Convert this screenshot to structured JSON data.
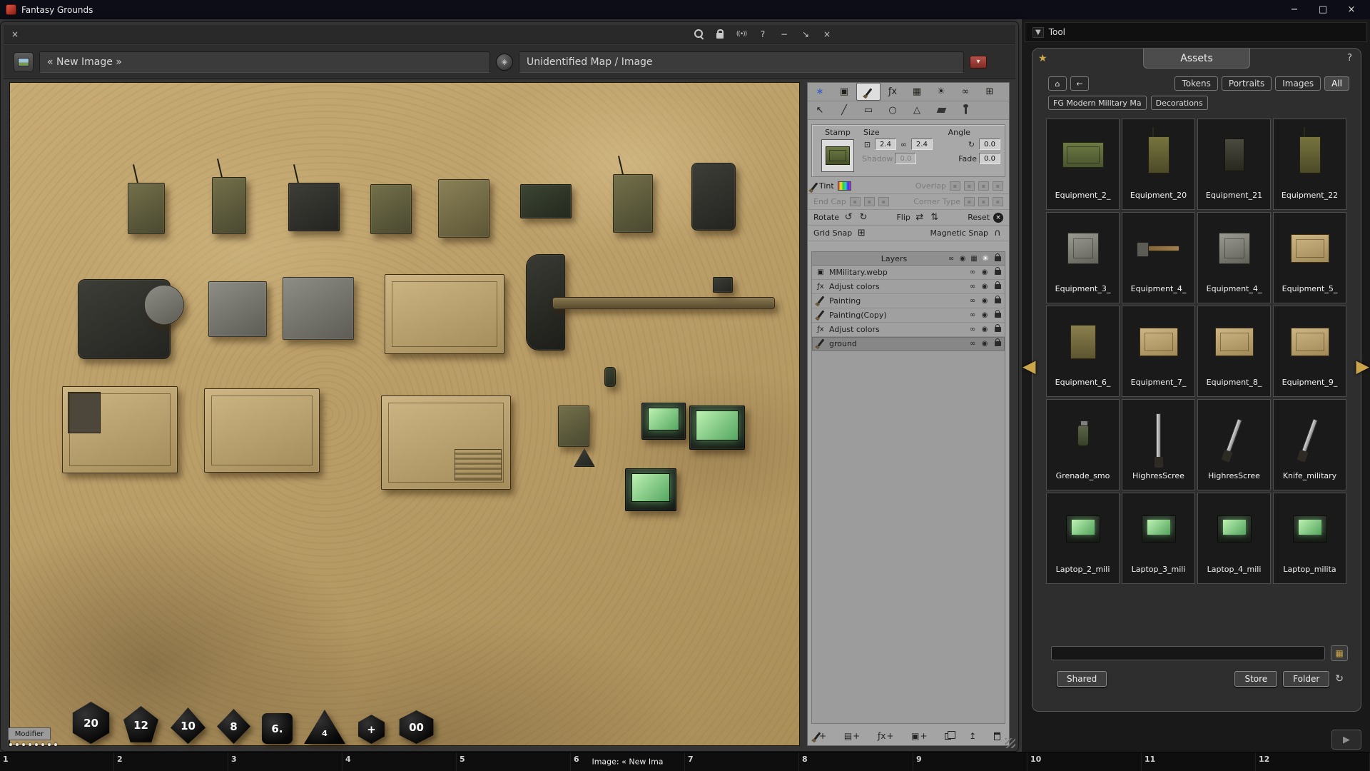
{
  "window": {
    "title": "Fantasy Grounds"
  },
  "icons": {
    "minimize": "−",
    "maximize": "□",
    "close": "×",
    "help": "?",
    "popout": "↘",
    "broadcast": "((•))",
    "dropdown": "▾",
    "compass": "∗",
    "layers_tool": "▣",
    "fx": "ƒx",
    "tiles": "▦",
    "sun": "☀",
    "link": "∞",
    "grid": "⊞",
    "pointer": "↖",
    "line": "╱",
    "rect": "▭",
    "ellipse": "○",
    "polygon": "△",
    "size": "⊡",
    "rotate_ccw": "↺",
    "rotate_cw": "↻",
    "flip_h": "⇄",
    "flip_v": "⇅",
    "reset": "×",
    "magnet": "∩",
    "eye": "◉",
    "image_layer": "▣",
    "home": "⌂",
    "back": "←",
    "arrow_left": "◀",
    "arrow_right": "▶",
    "refresh": "↻",
    "play": "▶",
    "star": "★",
    "export": "↥",
    "plus": "+",
    "group": "▤",
    "tool_caret": "▼",
    "die_glyph": "◈",
    "dot": "▪"
  },
  "image_window": {
    "name_value": "« New Image »",
    "type_value": "Unidentified Map / Image"
  },
  "stamp": {
    "title": "Stamp",
    "size_label": "Size",
    "angle_label": "Angle",
    "size_x": "2.4",
    "size_y": "2.4",
    "angle": "0.0",
    "shadow_label": "Shadow",
    "shadow_value": "0.0",
    "fade_label": "Fade",
    "fade_value": "0.0",
    "tint_label": "Tint",
    "overlap_label": "Overlap",
    "end_cap_label": "End Cap",
    "corner_type_label": "Corner Type",
    "rotate_label": "Rotate",
    "flip_label": "Flip",
    "reset_label": "Reset",
    "grid_snap_label": "Grid Snap",
    "magnetic_snap_label": "Magnetic Snap"
  },
  "layers_panel": {
    "title": "Layers",
    "items": [
      {
        "name": "MMilitary.webp",
        "type": "image"
      },
      {
        "name": "Adjust colors",
        "type": "fx"
      },
      {
        "name": "Painting",
        "type": "paint"
      },
      {
        "name": "Painting(Copy)",
        "type": "paint"
      },
      {
        "name": "Adjust colors",
        "type": "fx"
      },
      {
        "name": "ground",
        "type": "paint"
      }
    ]
  },
  "sidebar": {
    "tool_label": "Tool",
    "assets": {
      "title": "Assets",
      "tabs": [
        {
          "label": "Tokens"
        },
        {
          "label": "Portraits"
        },
        {
          "label": "Images"
        },
        {
          "label": "All"
        }
      ],
      "breadcrumbs": [
        {
          "label": "FG Modern Military Ma"
        },
        {
          "label": "Decorations"
        }
      ],
      "items": [
        {
          "label": "Equipment_2_",
          "kind": "crate-olive"
        },
        {
          "label": "Equipment_20",
          "kind": "radio"
        },
        {
          "label": "Equipment_21",
          "kind": "radio-dark"
        },
        {
          "label": "Equipment_22",
          "kind": "radio"
        },
        {
          "label": "Equipment_3_",
          "kind": "machine-gray"
        },
        {
          "label": "Equipment_4_",
          "kind": "tool"
        },
        {
          "label": "Equipment_4_",
          "kind": "machine-gray"
        },
        {
          "label": "Equipment_5_",
          "kind": "crate-tan"
        },
        {
          "label": "Equipment_6_",
          "kind": "box-olive"
        },
        {
          "label": "Equipment_7_",
          "kind": "crate-tan"
        },
        {
          "label": "Equipment_8_",
          "kind": "crate-tan"
        },
        {
          "label": "Equipment_9_",
          "kind": "crate-tan"
        },
        {
          "label": "Grenade_smo",
          "kind": "grenade"
        },
        {
          "label": "HighresScree",
          "kind": "sword"
        },
        {
          "label": "HighresScree",
          "kind": "knife"
        },
        {
          "label": "Knife_military",
          "kind": "knife"
        },
        {
          "label": "Laptop_2_mili",
          "kind": "laptop"
        },
        {
          "label": "Laptop_3_mili",
          "kind": "laptop"
        },
        {
          "label": "Laptop_4_mili",
          "kind": "laptop"
        },
        {
          "label": "Laptop_milita",
          "kind": "laptop"
        }
      ],
      "shared_label": "Shared",
      "store_label": "Store",
      "folder_label": "Folder"
    }
  },
  "dice_tray": {
    "modifier_label": "Modifier",
    "dice": [
      {
        "label": "20"
      },
      {
        "label": "12"
      },
      {
        "label": "10"
      },
      {
        "label": "8"
      },
      {
        "label": "6."
      },
      {
        "label": "4"
      },
      {
        "label": "+"
      },
      {
        "label": "00"
      }
    ]
  },
  "hotbar": {
    "slots": [
      {
        "number": "1"
      },
      {
        "number": "2"
      },
      {
        "number": "3"
      },
      {
        "number": "4"
      },
      {
        "number": "5"
      },
      {
        "number": "6"
      },
      {
        "number": "7"
      },
      {
        "number": "8"
      },
      {
        "number": "9"
      },
      {
        "number": "10"
      },
      {
        "number": "11"
      },
      {
        "number": "12"
      }
    ],
    "slot6_label": "Image: « New Ima"
  },
  "colors": {
    "accent_gold": "#c9a44a",
    "canvas_sand": "#bfa26b",
    "laptop_screen_green": "#8fe39b"
  }
}
